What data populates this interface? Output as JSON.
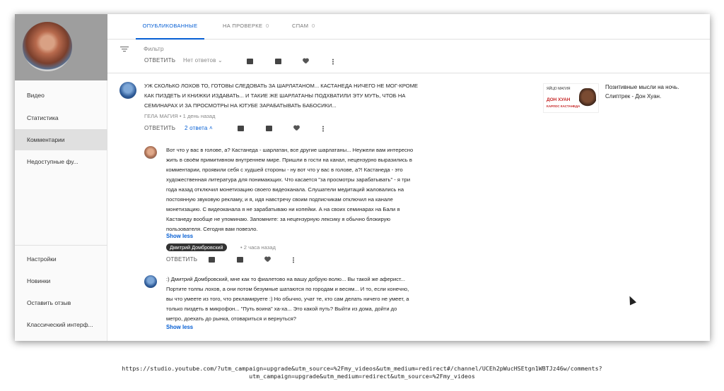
{
  "tabs": [
    {
      "label": "ОПУБЛИКОВАННЫЕ"
    },
    {
      "label": "НА ПРОВЕРКЕ",
      "count": "0"
    },
    {
      "label": "СПАМ",
      "count": "0"
    }
  ],
  "filter": {
    "placeholder": "Фильтр"
  },
  "sidebar": {
    "items": [
      {
        "label": "Видео"
      },
      {
        "label": "Статистика"
      },
      {
        "label": "Комментарии"
      },
      {
        "label": "Недоступные фу..."
      },
      {
        "label": "Настройки"
      },
      {
        "label": "Новинки"
      },
      {
        "label": "Оставить отзыв"
      },
      {
        "label": "Классический интерф..."
      }
    ]
  },
  "top_row": {
    "reply": "ОТВЕТИТЬ",
    "replies": "Нет ответов"
  },
  "comment1": {
    "lines": [
      "УЖ СКОЛЬКО ЛОХОВ ТО, ГОТОВЫ СЛЕДОВАТЬ ЗА ШАРЛАТАНОМ... КАСТАНЕДА НИЧЕГО НЕ МОГ-КРОМЕ",
      "КАК ПИЗДЕТЬ И КНИЖКИ ИЗДАВАТЬ... И ТАКИЕ ЖЕ ШАРЛАТАНЫ ПОДХВАТИЛИ ЭТУ МУТЬ, ЧТОБ НА",
      "СЕМИНАРАХ И ЗА ПРОСМОТРЫ НА ЮТУБЕ ЗАРАБАТЫВАТЬ БАБОСИКИ..."
    ],
    "author": "ГЕЛА МАГИЯ",
    "time": "1 день назад",
    "reply": "ОТВЕТИТЬ",
    "replies": "2 ответа"
  },
  "reply1": {
    "lines": [
      "Вот что у вас в голове, а? Кастанеда - шарлатан, все другие шарлатаны... Неужели вам интересно",
      "жить в своём примитивном внутреннем мире. Пришли в гости на канал, нецензурно выразились в",
      "комментарии, проявили себя с худшей стороны - ну вот  что у вас в голове, а?! Кастанеда - это",
      "художественная литература для понимающих.  Что касается \"за просмотры зарабатывать\" - я три",
      "года назад отключил монетизацию своего видеоканала.  Слушатели медитаций жаловались на",
      "постоянную звуковую рекламу, и я, идя навстречу своим подписчикам отключил на канале",
      "монетизацию. С видеоканала я не зарабатываю ни копейки. А на своих семинарах на Бали я",
      "Кастанеду вообще не упоминаю. Запомните: за нецензурную лексику я обычно блокирую",
      "пользователя. Сегодня вам повезло."
    ],
    "show_less": "Show less",
    "author": "Дмитрий Домбровский",
    "time": "2 часа назад",
    "reply": "ОТВЕТИТЬ"
  },
  "reply2": {
    "lines": [
      ":)  Дмитрий Домбровский, мне как то фиалетово на вашу добрую волю... Вы такой же аферист...",
      "Портите толпы лохов, а они потом безумные шатаются по городам и весям... И то, если конечно,",
      "вы что умеете из того, что рекламируете :) Но обычно, учат те, кто сам делать ничего не умеет, а",
      "только пиздеть в микрофон... \"Путь воина\" ха-ха... Это какой путь? Выйти из дома, дойти до",
      "метро, доехать до рынка, отовариться и вернуться?"
    ],
    "show_less": "Show less"
  },
  "video": {
    "title": "Позитивные мысли на ночь. Слиптрек - Дон Хуан.",
    "thumb_small": "ЯЙЦО МАГИЯ",
    "thumb_title": "ДОН ХУАН",
    "thumb_sub": "КАРЛОС КАСТАНЕДА"
  },
  "url": {
    "line1": "https://studio.youtube.com/?utm_campaign=upgrade&utm_source=%2Fmy_videos&utm_medium=redirect#/channel/UCEh2pWucHSEtgn1WBTJz46w/comments?",
    "line2": "utm_campaign=upgrade&utm_medium=redirect&utm_source=%2Fmy_videos"
  },
  "colors": {
    "accent": "#065fd4",
    "sidebar_active": "#e0e0e0"
  }
}
